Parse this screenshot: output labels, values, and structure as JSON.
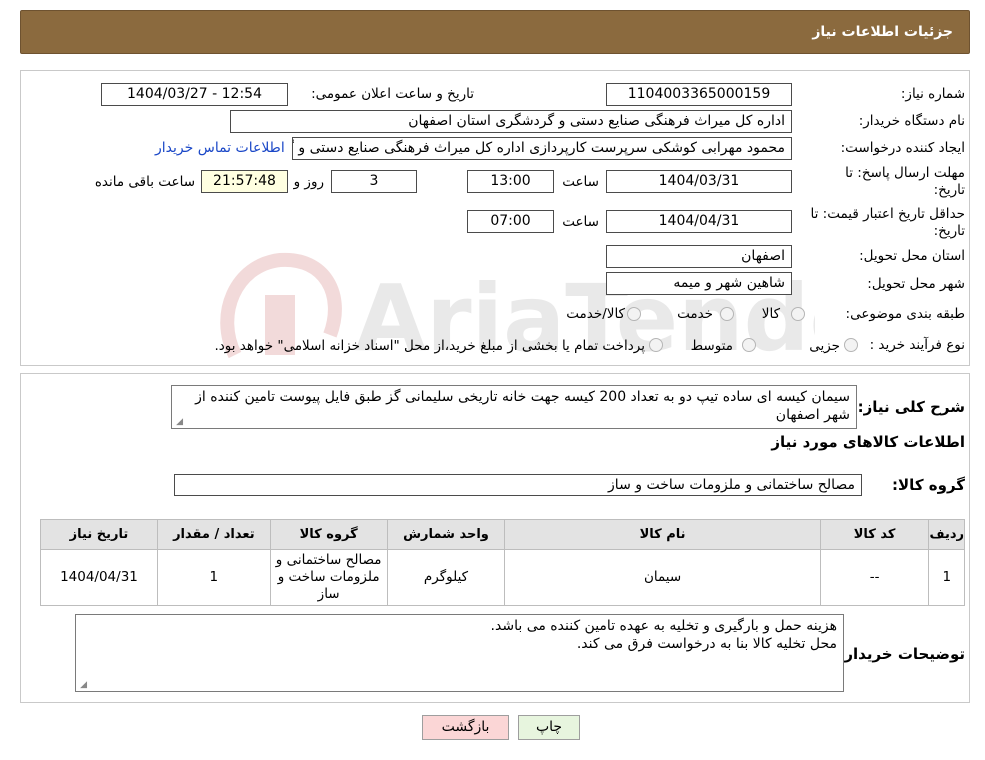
{
  "header": {
    "title": "جزئیات اطلاعات نیاز"
  },
  "form": {
    "need_number_label": "شماره نیاز:",
    "need_number": "1104003365000159",
    "announce_label": "تاریخ و ساعت اعلان عمومی:",
    "announce_value": "1404/03/27 - 12:54",
    "buyer_org_label": "نام دستگاه خریدار:",
    "buyer_org": "اداره کل میراث فرهنگی  صنایع دستی و گردشگری استان اصفهان",
    "creator_label": "ایجاد کننده درخواست:",
    "creator": "محمود مهرابی کوشکی سرپرست کارپردازی اداره کل میراث فرهنگی  صنایع دستی و گردشگری استان اصفهان",
    "contact_link": "اطلاعات تماس خریدار",
    "deadline_label": "مهلت ارسال پاسخ: تا تاریخ:",
    "deadline_date": "1404/03/31",
    "time_label": "ساعت",
    "deadline_time": "13:00",
    "days_value": "3",
    "days_label": "روز و",
    "remaining_time": "21:57:48",
    "remaining_label": "ساعت باقی مانده",
    "validity_label": "حداقل تاریخ اعتبار قیمت: تا تاریخ:",
    "validity_date": "1404/04/31",
    "validity_time": "07:00",
    "province_label": "استان محل تحویل:",
    "province": "اصفهان",
    "city_label": "شهر محل تحویل:",
    "city": "شاهین شهر و میمه",
    "category_label": "طبقه بندی موضوعی:",
    "category_goods": "کالا",
    "category_service": "خدمت",
    "category_both": "کالا/خدمت",
    "purchase_type_label": "نوع فرآیند خرید :",
    "purchase_minor": "جزیی",
    "purchase_medium": "متوسط",
    "purchase_note": "پرداخت تمام یا بخشی از مبلغ خرید،از محل \"اسناد خزانه اسلامی\" خواهد بود."
  },
  "summary": {
    "label": "شرح کلی نیاز:",
    "text": "سیمان کیسه ای ساده تیپ دو به تعداد 200 کیسه جهت خانه تاریخی سلیمانی گز طبق فایل پیوست تامین کننده از شهر اصفهان"
  },
  "goods": {
    "section_title": "اطلاعات کالاهای مورد نیاز",
    "group_label": "گروه کالا:",
    "group_value": "مصالح ساختمانی و ملزومات ساخت و ساز",
    "columns": [
      "ردیف",
      "کد کالا",
      "نام کالا",
      "واحد شمارش",
      "گروه کالا",
      "تعداد / مقدار",
      "تاریخ نیاز"
    ],
    "rows": [
      {
        "row": "1",
        "code": "--",
        "name": "سیمان",
        "unit": "کیلوگرم",
        "group": "مصالح ساختمانی و ملزومات ساخت و ساز",
        "qty": "1",
        "date": "1404/04/31"
      }
    ]
  },
  "buyer_notes": {
    "label": "توضیحات خریدار:",
    "line1": "هزینه حمل و بارگیری و تخلیه به عهده تامین کننده می باشد.",
    "line2": "محل تخلیه کالا بنا به درخواست فرق می کند."
  },
  "buttons": {
    "print": "چاپ",
    "back": "بازگشت"
  },
  "watermark": {
    "text": "AriaTender.neT"
  }
}
